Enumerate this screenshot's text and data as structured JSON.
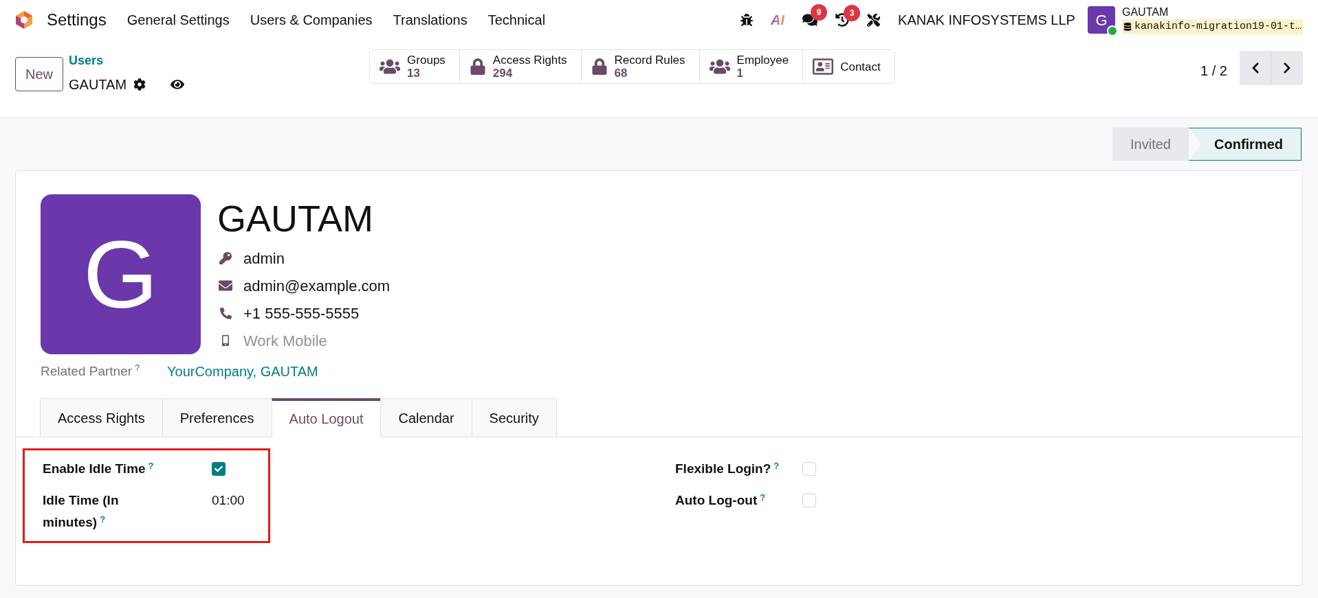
{
  "navbar": {
    "app": "Settings",
    "menus": [
      "General Settings",
      "Users & Companies",
      "Translations",
      "Technical"
    ],
    "systray": [
      {
        "kind": "bug"
      },
      {
        "kind": "ai",
        "label": "AI"
      },
      {
        "kind": "chat",
        "badge": "9"
      },
      {
        "kind": "activity",
        "badge": "3"
      },
      {
        "kind": "tools"
      }
    ],
    "company": "KANAK INFOSYSTEMS LLP",
    "user": {
      "initial": "G",
      "name": "GAUTAM",
      "database": "kanakinfo-migration19-01-t…",
      "online": true
    }
  },
  "control_panel": {
    "new_button": "New",
    "breadcrumb": "Users",
    "record": "GAUTAM",
    "smart_buttons": [
      {
        "kind": "group",
        "label": "Groups",
        "count": "13"
      },
      {
        "kind": "lock",
        "label": "Access Rights",
        "count": "294"
      },
      {
        "kind": "lock",
        "label": "Record Rules",
        "count": "68"
      },
      {
        "kind": "group",
        "label": "Employee",
        "count": "1"
      },
      {
        "kind": "card",
        "label": "Contact"
      }
    ],
    "pager": "1 / 2"
  },
  "statusbar": [
    {
      "label": "Invited",
      "selected": false
    },
    {
      "label": "Confirmed",
      "selected": true
    }
  ],
  "form": {
    "avatar_initial": "G",
    "name": "GAUTAM",
    "fields": [
      {
        "kind": "login",
        "value": "admin"
      },
      {
        "kind": "email",
        "value": "admin@example.com"
      },
      {
        "kind": "phone",
        "value": "+1 555-555-5555"
      },
      {
        "kind": "mobile",
        "placeholder": "Work Mobile"
      }
    ],
    "related_partner": {
      "label": "Related Partner",
      "help": "?",
      "value": "YourCompany, GAUTAM"
    },
    "tabs": [
      {
        "label": "Access Rights",
        "selected": false
      },
      {
        "label": "Preferences",
        "selected": false
      },
      {
        "label": "Auto Logout",
        "selected": true
      },
      {
        "label": "Calendar",
        "selected": false
      },
      {
        "label": "Security",
        "selected": false
      }
    ],
    "left_group": {
      "highlighted": true,
      "rows": [
        {
          "kind": "checkbox",
          "label": "Enable Idle Time",
          "help": "?",
          "checked": true
        },
        {
          "kind": "text",
          "label": "Idle Time (In minutes)",
          "help": "?",
          "value": "01:00"
        }
      ]
    },
    "right_group": {
      "rows": [
        {
          "kind": "checkbox",
          "label": "Flexible Login?",
          "help": "?",
          "checked": false
        },
        {
          "kind": "checkbox",
          "label": "Auto Log-out",
          "help": "?",
          "checked": false
        }
      ]
    }
  }
}
